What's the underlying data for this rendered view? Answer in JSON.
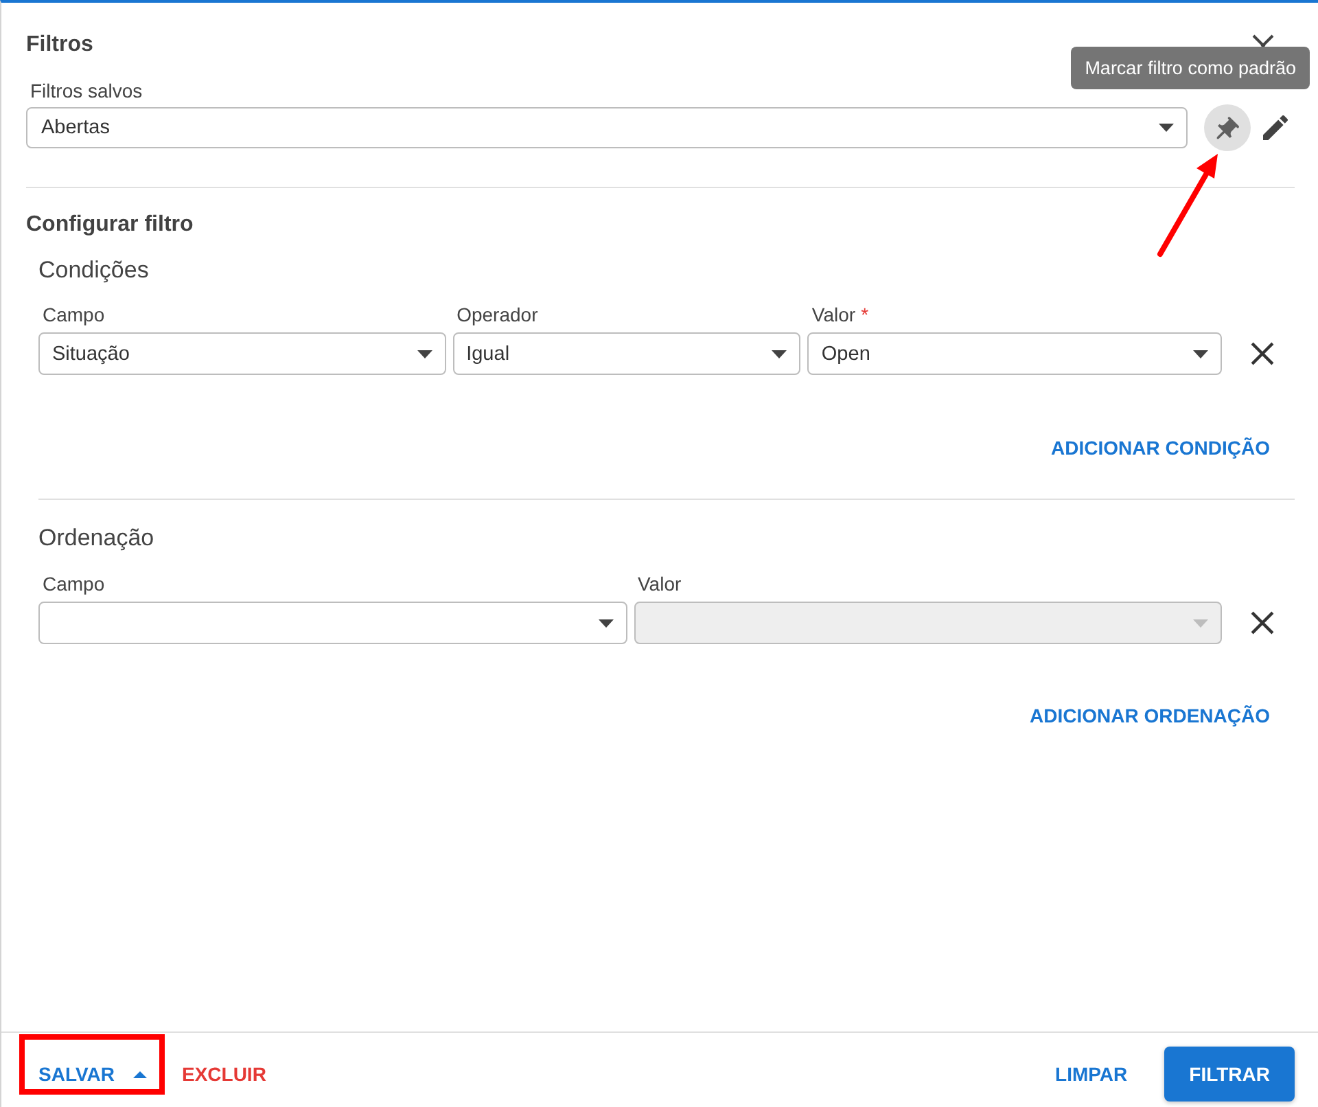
{
  "header": {
    "title": "Filtros"
  },
  "saved_filters": {
    "label": "Filtros salvos",
    "value": "Abertas",
    "pin_button": {
      "tooltip": "Marcar filtro como padrão",
      "pointed_at": true
    }
  },
  "configure": {
    "title": "Configurar filtro"
  },
  "conditions": {
    "title": "Condições",
    "rows": [
      {
        "fields": [
          {
            "label": "Campo",
            "value": "Situação",
            "disabled": false
          },
          {
            "label": "Operador",
            "value": "Igual",
            "disabled": false
          },
          {
            "label": "Valor",
            "required_mark": "*",
            "value": "Open",
            "disabled": false
          }
        ]
      }
    ],
    "add_button": "ADICIONAR CONDIÇÃO"
  },
  "sorting": {
    "title": "Ordenação",
    "rows": [
      {
        "fields": [
          {
            "label": "Campo",
            "disabled": false
          },
          {
            "label": "Valor",
            "disabled": true
          }
        ]
      }
    ],
    "add_button": "ADICIONAR ORDENAÇÃO"
  },
  "footer": {
    "save_button": {
      "label": "SALVAR",
      "highlighted": true
    },
    "delete_button": "EXCLUIR",
    "clear_button": "LIMPAR",
    "apply_button": "FILTRAR"
  }
}
